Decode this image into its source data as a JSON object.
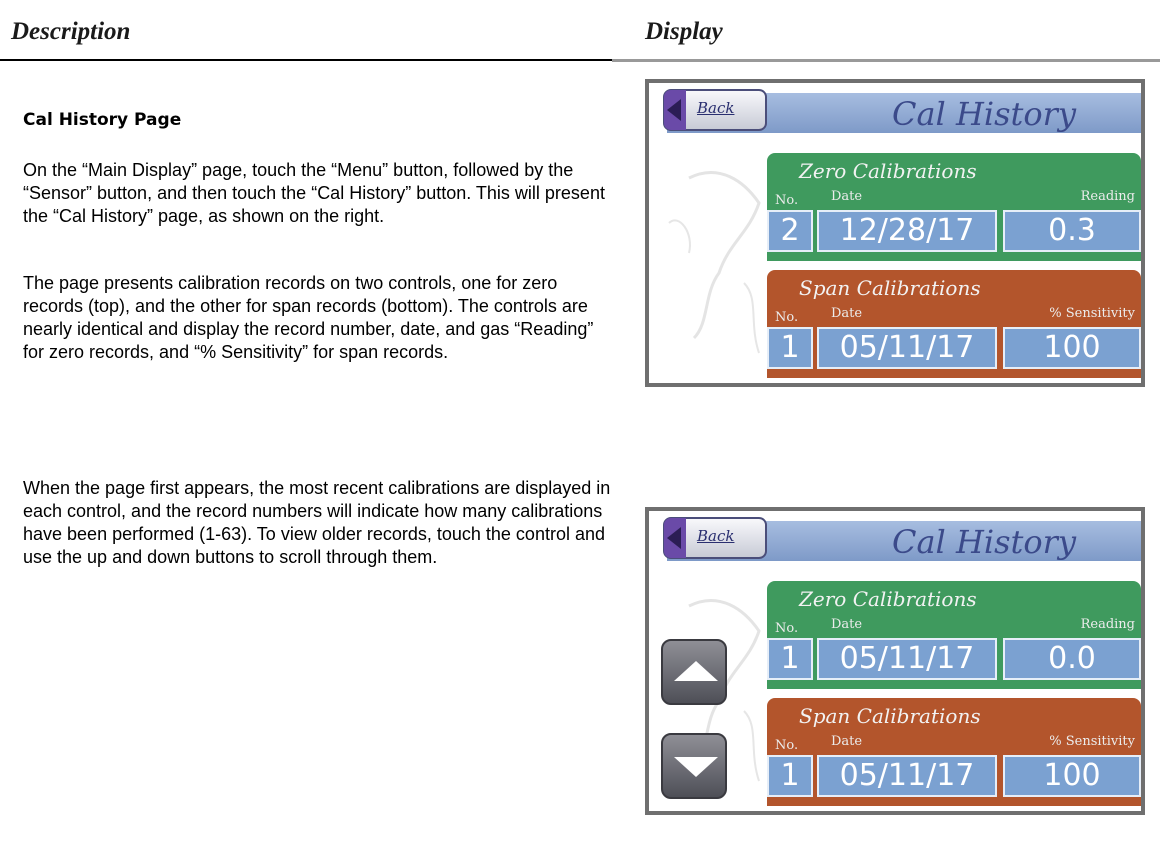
{
  "header": {
    "description_label": "Description",
    "display_label": "Display"
  },
  "section": {
    "title": "Cal History Page",
    "paragraphs": [
      "On the “Main Display” page, touch the “Menu” button, followed by the “Sensor” button, and then touch the “Cal History” button.  This will present the “Cal History” page, as shown on the right.",
      "The page presents calibration records on two controls, one for zero records (top), and the other for span records (bottom).  The controls are nearly identical and display the record number, date, and gas “Reading” for zero records, and “% Sensitivity” for span records.",
      "When the page first appears, the most recent calibrations are displayed in each control, and the record numbers will indicate how many calibrations have been performed (1-63).  To view older records, touch the control and use the up and down buttons to scroll through them."
    ]
  },
  "screens": [
    {
      "title": "Cal History",
      "back_label": "Back",
      "zero": {
        "heading": "Zero Calibrations",
        "no_label": "No.",
        "date_label": "Date",
        "value_label": "Reading",
        "no": "2",
        "date": "12/28/17",
        "value": "0.3"
      },
      "span": {
        "heading": "Span Calibrations",
        "no_label": "No.",
        "date_label": "Date",
        "value_label": "% Sensitivity",
        "no": "1",
        "date": "05/11/17",
        "value": "100"
      }
    },
    {
      "title": "Cal History",
      "back_label": "Back",
      "zero": {
        "heading": "Zero Calibrations",
        "no_label": "No.",
        "date_label": "Date",
        "value_label": "Reading",
        "no": "1",
        "date": "05/11/17",
        "value": "0.0"
      },
      "span": {
        "heading": "Span Calibrations",
        "no_label": "No.",
        "date_label": "Date",
        "value_label": "% Sensitivity",
        "no": "1",
        "date": "05/11/17",
        "value": "100"
      },
      "up_icon": "up-arrow",
      "down_icon": "down-arrow"
    }
  ],
  "colors": {
    "zero_panel": "#3f9a5e",
    "span_panel": "#b3552c",
    "value_cell": "#7ba1d1",
    "title_bar": "#94acd6"
  }
}
